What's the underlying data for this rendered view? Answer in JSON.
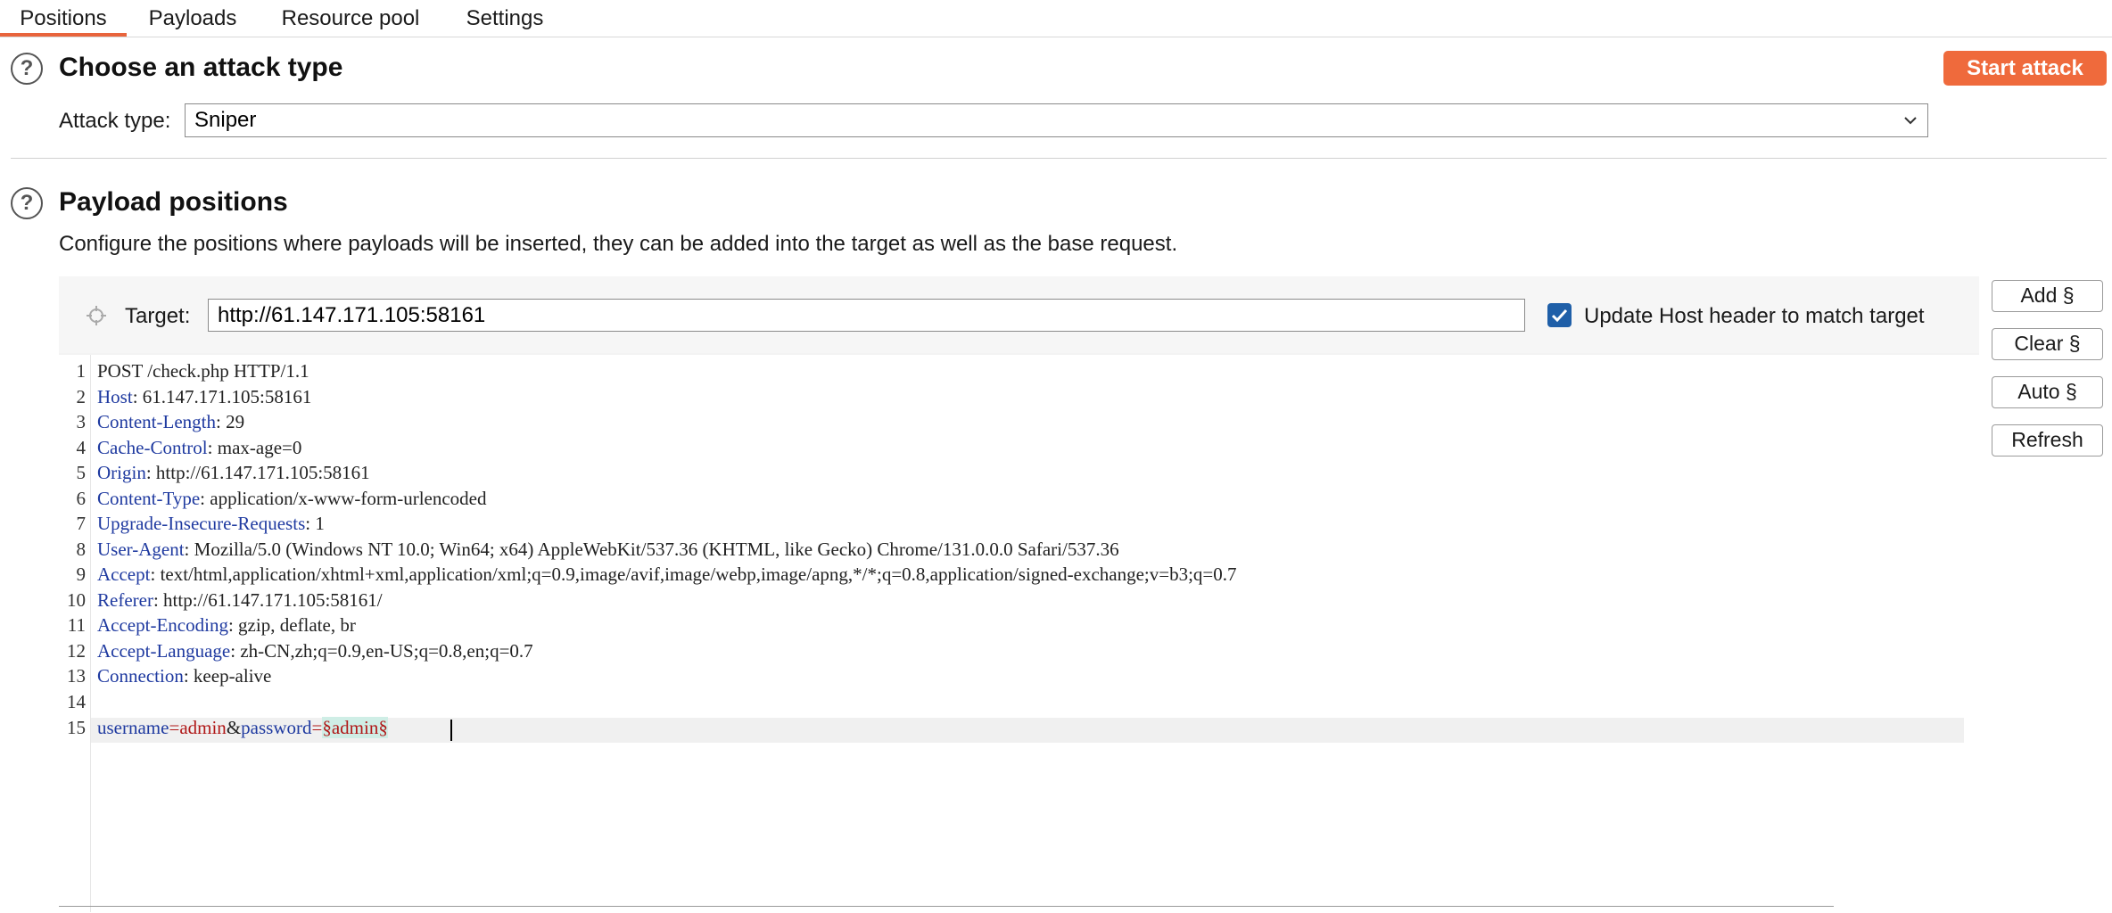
{
  "tabs": [
    {
      "label": "Positions",
      "active": true
    },
    {
      "label": "Payloads"
    },
    {
      "label": "Resource pool"
    },
    {
      "label": "Settings"
    }
  ],
  "attack_section": {
    "title": "Choose an attack type",
    "start_button": "Start attack",
    "attack_type_label": "Attack type:",
    "attack_type_value": "Sniper"
  },
  "positions_section": {
    "title": "Payload positions",
    "description": "Configure the positions where payloads will be inserted, they can be added into the target as well as the base request.",
    "target_label": "Target:",
    "target_value": "http://61.147.171.105:58161",
    "update_host_label": "Update Host header to match target",
    "update_host_checked": true
  },
  "side_buttons": {
    "add": "Add §",
    "clear": "Clear §",
    "auto": "Auto §",
    "refresh": "Refresh"
  },
  "request": {
    "line_numbers": [
      "1",
      "2",
      "3",
      "4",
      "5",
      "6",
      "7",
      "8",
      "9",
      "10",
      "11",
      "12",
      "13",
      "14",
      "15"
    ],
    "request_line": "POST /check.php HTTP/1.1",
    "headers": [
      {
        "name": "Host",
        "value": " 61.147.171.105:58161"
      },
      {
        "name": "Content-Length",
        "value": " 29"
      },
      {
        "name": "Cache-Control",
        "value": " max-age=0"
      },
      {
        "name": "Origin",
        "value": " http://61.147.171.105:58161"
      },
      {
        "name": "Content-Type",
        "value": " application/x-www-form-urlencoded"
      },
      {
        "name": "Upgrade-Insecure-Requests",
        "value": " 1"
      },
      {
        "name": "User-Agent",
        "value": " Mozilla/5.0 (Windows NT 10.0; Win64; x64) AppleWebKit/537.36 (KHTML, like Gecko) Chrome/131.0.0.0 Safari/537.36"
      },
      {
        "name": "Accept",
        "value": " text/html,application/xhtml+xml,application/xml;q=0.9,image/avif,image/webp,image/apng,*/*;q=0.8,application/signed-exchange;v=b3;q=0.7"
      },
      {
        "name": "Referer",
        "value": " http://61.147.171.105:58161/"
      },
      {
        "name": "Accept-Encoding",
        "value": " gzip, deflate, br"
      },
      {
        "name": "Accept-Language",
        "value": " zh-CN,zh;q=0.9,en-US;q=0.8,en;q=0.7"
      },
      {
        "name": "Connection",
        "value": " keep-alive"
      }
    ],
    "body": {
      "p1_name": "username",
      "eq1": "=",
      "p1_value": "admin",
      "amp": "&",
      "p2_name": "password",
      "eq2": "=",
      "p2_payload": "§admin§"
    }
  },
  "colors": {
    "accent": "#ef6a3c",
    "tab_underline": "#e8643c",
    "checkbox": "#1f5fa8",
    "header_key": "#1f3aa0",
    "param_value": "#b01818",
    "payload_highlight": "#cfeee6"
  }
}
